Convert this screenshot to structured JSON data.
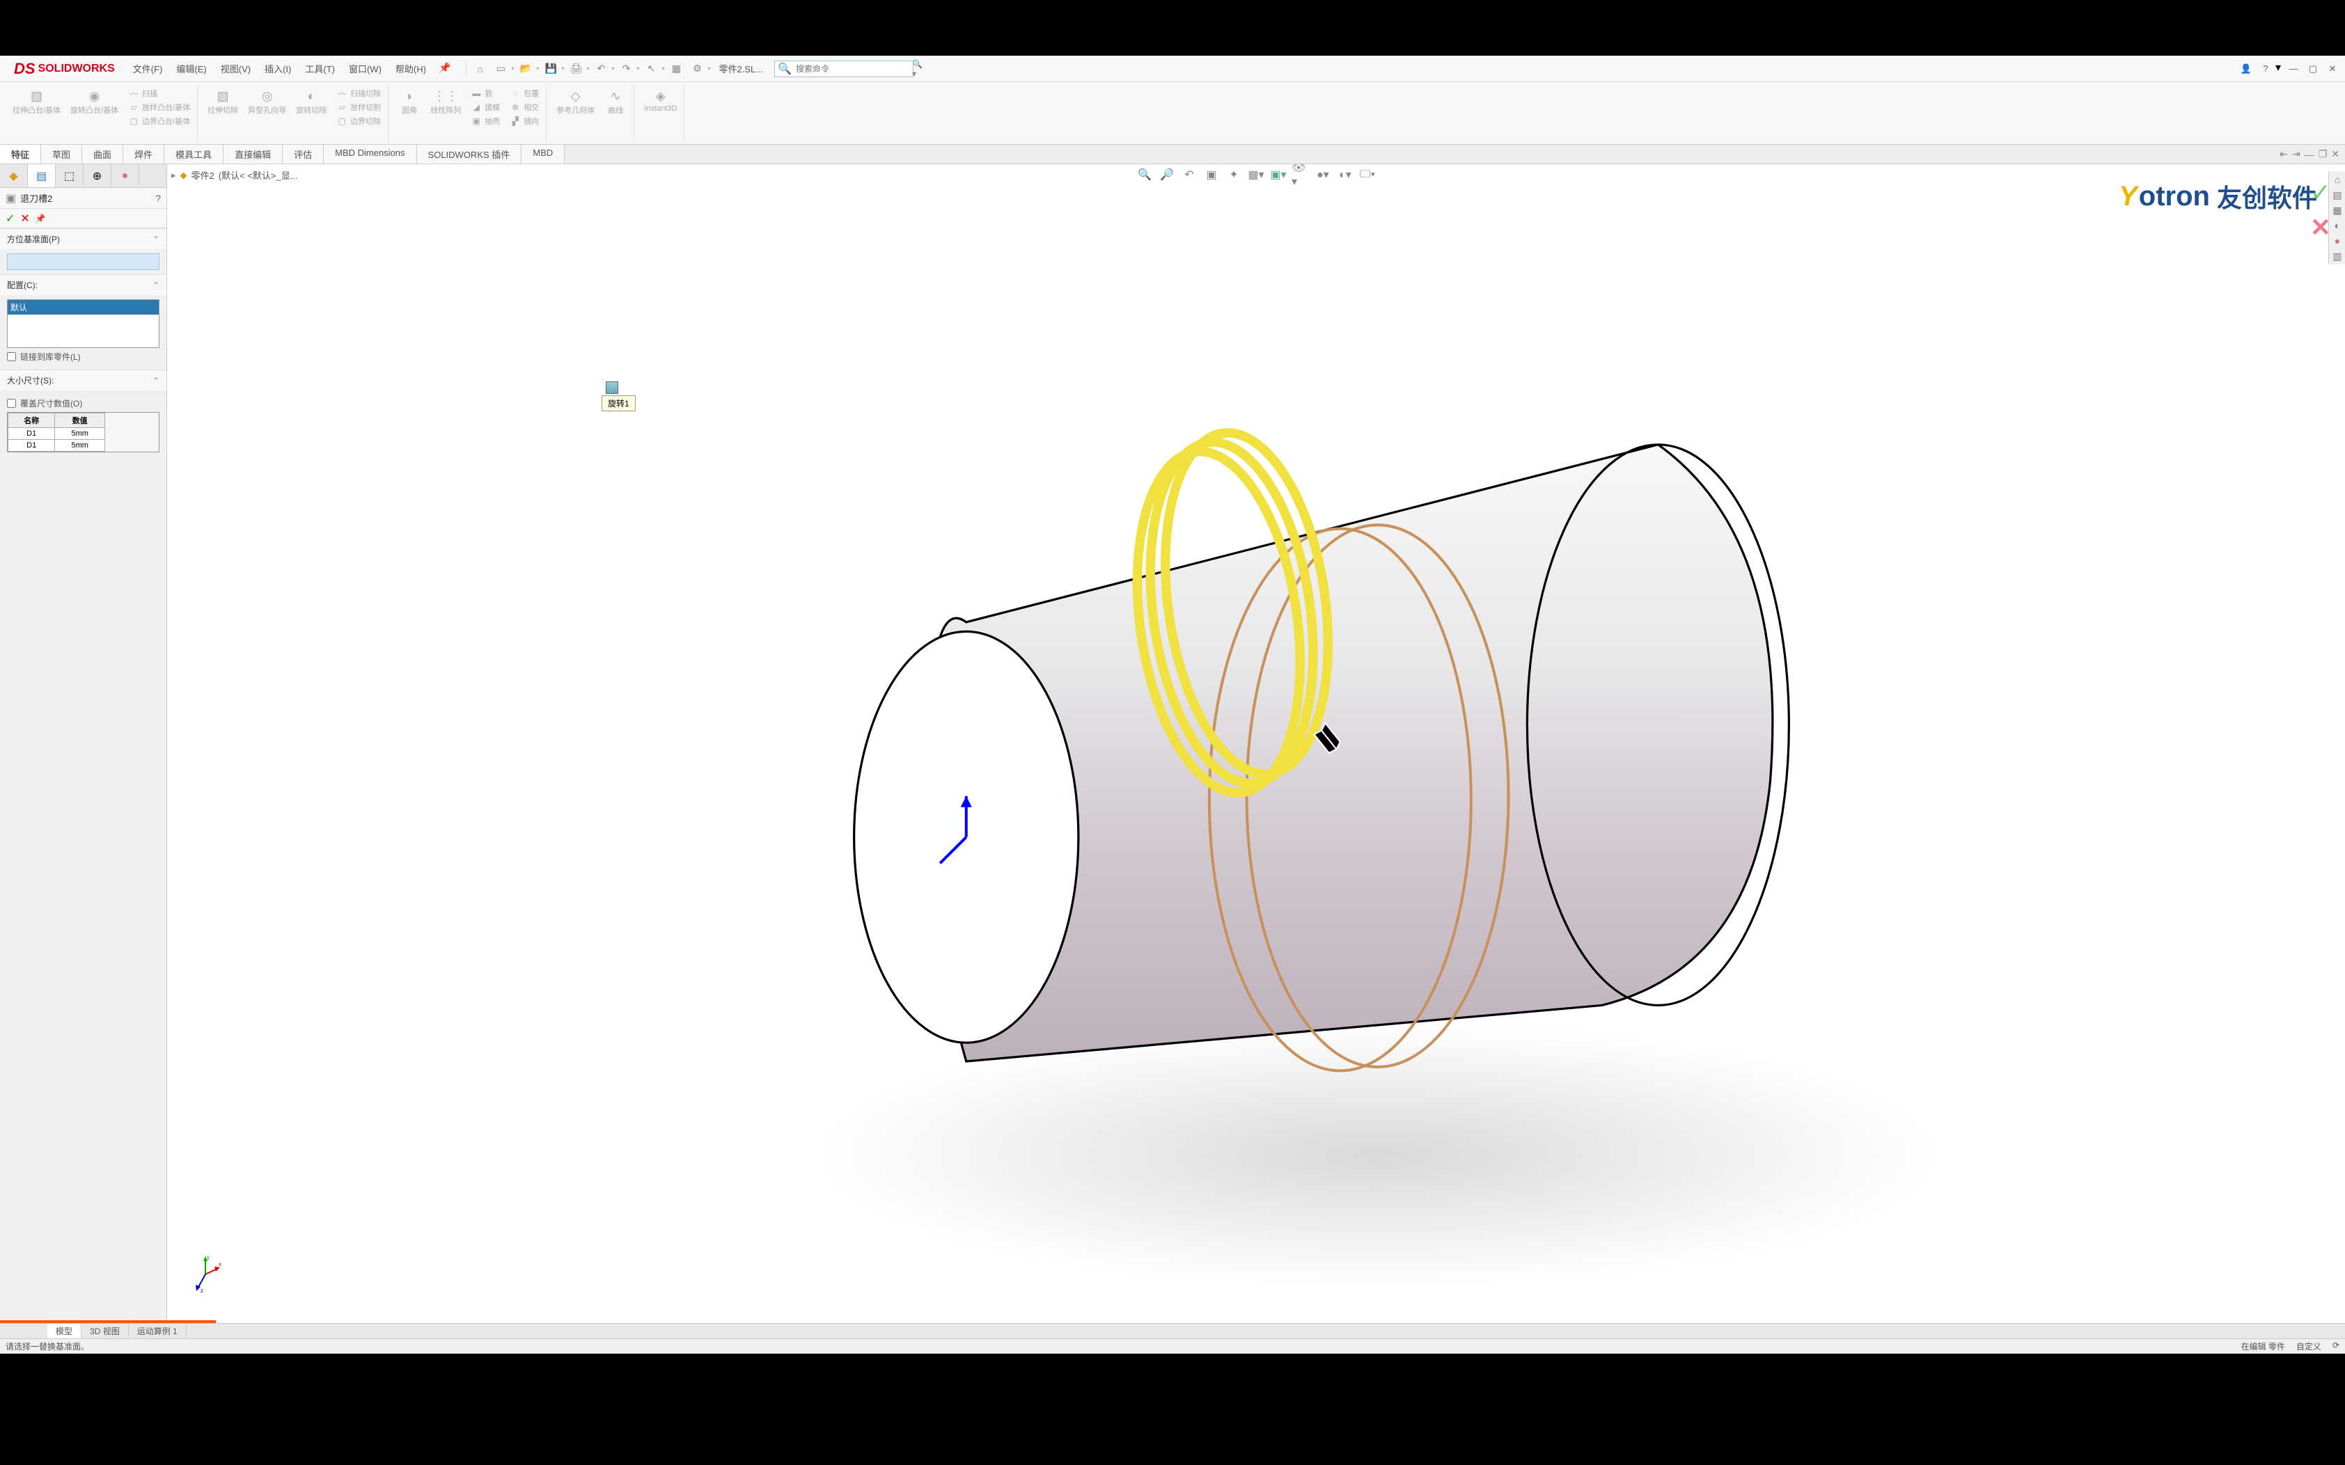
{
  "logo": "SOLIDWORKS",
  "menu": {
    "file": "文件(F)",
    "edit": "编辑(E)",
    "view": "视图(V)",
    "insert": "插入(I)",
    "tools": "工具(T)",
    "window": "窗口(W)",
    "help": "帮助(H)"
  },
  "docName": "零件2.SL...",
  "searchPlaceholder": "搜索命令",
  "ribbon": {
    "extrude": "拉伸凸台/基体",
    "revolve": "旋转凸台/基体",
    "sweep": "扫描",
    "loft": "放样凸台/基体",
    "boundary": "边界凸台/基体",
    "extrudeCut": "拉伸切除",
    "hole": "异型孔向导",
    "revolveCut": "旋转切除",
    "sweepCut": "扫描切除",
    "loftCut": "放样切割",
    "boundaryCut": "边界切除",
    "fillet": "圆角",
    "pattern": "线性阵列",
    "rib": "筋",
    "draft": "拔模",
    "shell": "抽壳",
    "wrap": "包覆",
    "intersect": "相交",
    "mirror": "镜向",
    "refGeom": "参考几何体",
    "curves": "曲线",
    "instant3d": "Instant3D"
  },
  "tabs": {
    "features": "特征",
    "sketch": "草图",
    "surfaces": "曲面",
    "weldments": "焊件",
    "moldTools": "模具工具",
    "directEdit": "直接编辑",
    "evaluate": "评估",
    "mbd": "MBD Dimensions",
    "addins": "SOLIDWORKS 插件",
    "mbdTab": "MBD"
  },
  "breadcrumb": {
    "part": "零件2",
    "config": "(默认< <默认>_显..."
  },
  "propertyManager": {
    "title": "退刀槽2",
    "sectionDatum": "方位基准面(P)",
    "sectionConfig": "配置(C):",
    "configDefault": "默认",
    "linkToLib": "链接到库零件(L)",
    "sectionSize": "大小尺寸(S):",
    "overrideDim": "覆盖尺寸数值(O)",
    "colName": "名称",
    "colValue": "数值",
    "d1": "D1",
    "v1": "5mm",
    "d2": "D1",
    "v2": "5mm"
  },
  "tooltip": "旋转1",
  "watermark": {
    "brand": "otron",
    "cn": "友创软件"
  },
  "bottomTabs": {
    "model": "模型",
    "view3d": "3D 视图",
    "motion": "运动算例 1"
  },
  "status": {
    "prompt": "请选择一替换基准面。",
    "editing": "在编辑 零件",
    "custom": "自定义"
  }
}
